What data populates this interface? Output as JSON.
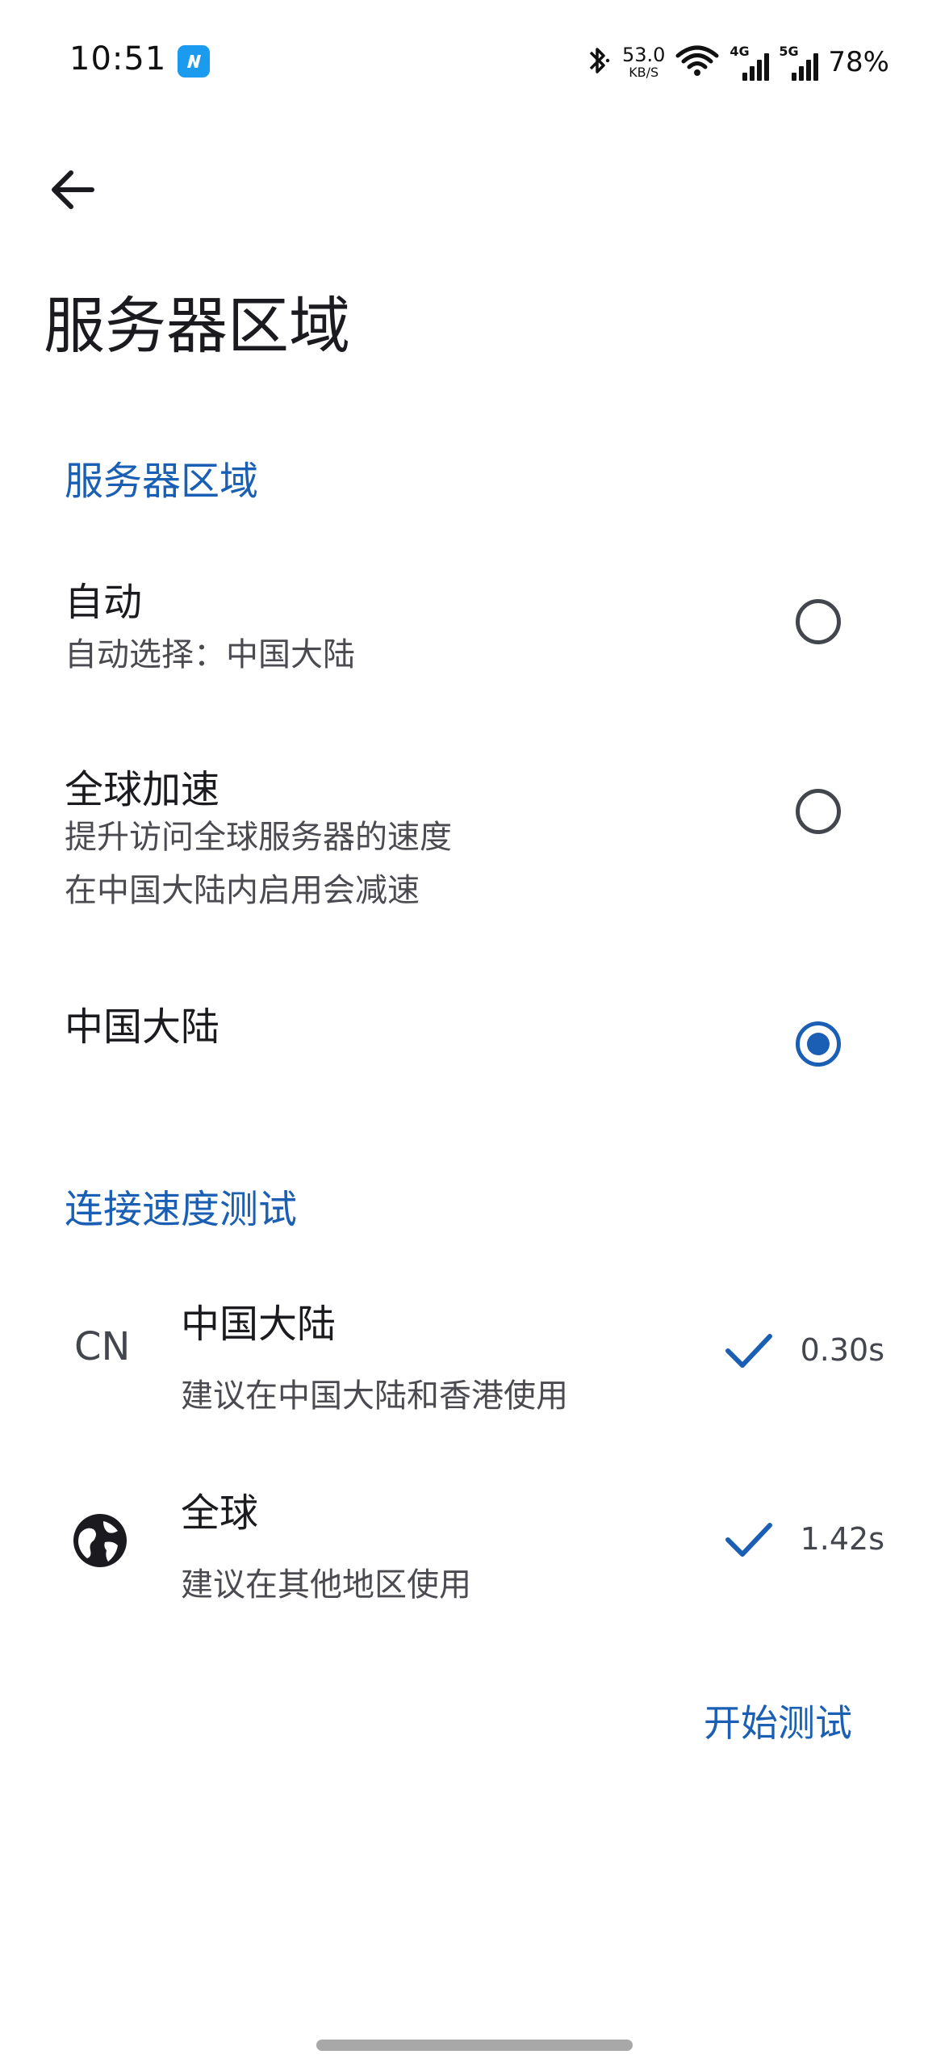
{
  "status_bar": {
    "time": "10:51",
    "net_speed_value": "53.0",
    "net_speed_unit": "KB/S",
    "signal_1_label": "4G",
    "signal_2_label": "5G",
    "battery": "78%"
  },
  "header": {
    "title": "服务器区域"
  },
  "region_section": {
    "heading": "服务器区域",
    "options": [
      {
        "title": "自动",
        "lines": [
          "自动选择：中国大陆"
        ],
        "selected": false
      },
      {
        "title": "全球加速",
        "lines": [
          "提升访问全球服务器的速度",
          "在中国大陆内启用会减速"
        ],
        "selected": false
      },
      {
        "title": "中国大陆",
        "lines": [],
        "selected": true
      }
    ]
  },
  "speed_section": {
    "heading": "连接速度测试",
    "rows": [
      {
        "icon_label": "CN",
        "icon": "cn-text-icon",
        "title": "中国大陆",
        "subtitle": "建议在中国大陆和香港使用",
        "result": "0.30s",
        "status_icon": "check-icon"
      },
      {
        "icon": "globe-icon",
        "title": "全球",
        "subtitle": "建议在其他地区使用",
        "result": "1.42s",
        "status_icon": "check-icon"
      }
    ],
    "start_button": "开始测试"
  },
  "colors": {
    "accent": "#1a5fb4",
    "text_primary": "#1b1b1f",
    "text_secondary": "#4a4a50"
  }
}
